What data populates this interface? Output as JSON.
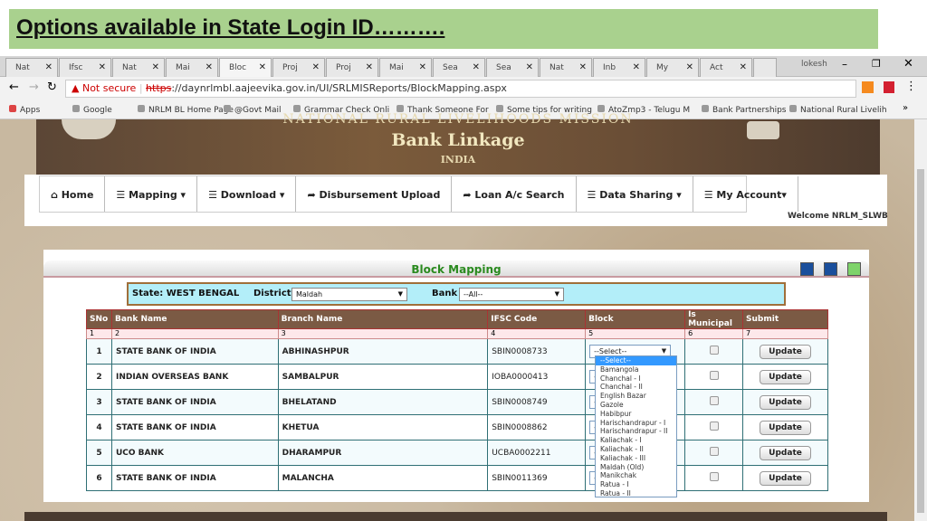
{
  "slide_title": "Options available in State Login ID……….",
  "browser": {
    "tabs": [
      "Nat",
      "Ifsc",
      "Nat",
      "Mai",
      "Bloc",
      "Proj",
      "Proj",
      "Mai",
      "Sea",
      "Sea",
      "Nat",
      "Inb",
      "My",
      "Act"
    ],
    "active_tab": 4,
    "profile": "lokesh",
    "security": "Not secure",
    "url_scheme": "https",
    "url_rest": "://daynrlmbl.aajeevika.gov.in/UI/SRLMISReports/BlockMapping.aspx",
    "bookmarks": [
      "Apps",
      "Google",
      "NRLM BL Home Page",
      "@Govt Mail",
      "Grammar Check Onli",
      "Thank Someone For",
      "Some tips for writing",
      "AtoZmp3 - Telugu M",
      "Bank Partnerships",
      "National Rural Livelih"
    ]
  },
  "site": {
    "header_top": "NATIONAL RURAL LIVELIHOODS MISSION",
    "header_title": "Bank Linkage",
    "header_sub": "INDIA",
    "nav": [
      "Home",
      "Mapping ▾",
      "Download ▾",
      "Disbursement Upload",
      "Loan A/c Search",
      "Data Sharing ▾",
      "My Account▾"
    ],
    "nav_icons": [
      "home-icon",
      "list-icon",
      "list-icon",
      "share-icon",
      "share-icon",
      "list-icon",
      "list-icon"
    ],
    "welcome": "Welcome NRLM_SLWB"
  },
  "panel": {
    "title": "Block Mapping",
    "state": "State: WEST BENGAL",
    "district_label": "District",
    "district_value": "Maldah",
    "bank_label": "Bank",
    "bank_value": "--All--"
  },
  "table": {
    "headers": [
      "SNo",
      "Bank Name",
      "Branch Name",
      "IFSC Code",
      "Block",
      "Is Municipal",
      "Submit"
    ],
    "numbers": [
      "1",
      "2",
      "3",
      "4",
      "5",
      "6",
      "7"
    ],
    "rows": [
      [
        "1",
        "STATE BANK OF INDIA",
        "ABHINASHPUR",
        "SBIN0008733"
      ],
      [
        "2",
        "INDIAN OVERSEAS BANK",
        "SAMBALPUR",
        "IOBA0000413"
      ],
      [
        "3",
        "STATE BANK OF INDIA",
        "BHELATAND",
        "SBIN0008749"
      ],
      [
        "4",
        "STATE BANK OF INDIA",
        "KHETUA",
        "SBIN0008862"
      ],
      [
        "5",
        "UCO BANK",
        "DHARAMPUR",
        "UCBA0002211"
      ],
      [
        "6",
        "STATE BANK OF INDIA",
        "MALANCHA",
        "SBIN0011369"
      ]
    ],
    "block_select": "--Select--",
    "update_label": "Update"
  },
  "block_options": [
    "--Select--",
    "Bamangola",
    "Chanchal - I",
    "Chanchal - II",
    "English Bazar",
    "Gazole",
    "Habibpur",
    "Harischandrapur - I",
    "Harischandrapur - II",
    "Kaliachak - I",
    "Kaliachak - II",
    "Kaliachak - III",
    "Maldah (Old)",
    "Manikchak",
    "Ratua - I",
    "Ratua - II"
  ]
}
